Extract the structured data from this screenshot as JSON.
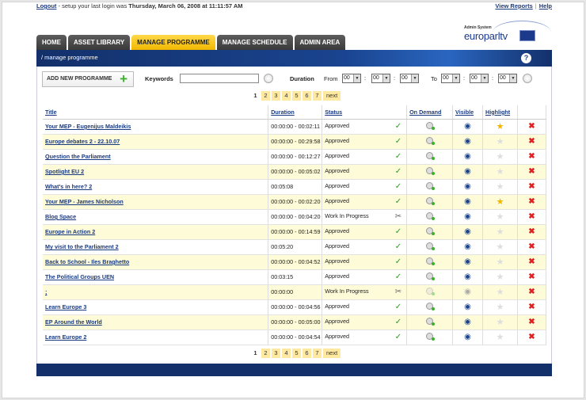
{
  "topbar": {
    "logout": "Logout",
    "message_prefix": " - setup your last login was ",
    "last_login": "Thursday, March 06, 2008 at 11:11:57 AM",
    "view_reports": "View Reports",
    "sep": "|",
    "help": "Help"
  },
  "tabs": [
    "HOME",
    "ASSET LIBRARY",
    "MANAGE PROGRAMME",
    "MANAGE SCHEDULE",
    "ADMIN AREA"
  ],
  "logo": {
    "small": "Admin System",
    "brand": "europarltv"
  },
  "breadcrumb": "/ manage programme",
  "help_icon": "?",
  "filter": {
    "add_button": "ADD NEW PROGRAMME",
    "keywords_label": "Keywords",
    "keywords_value": "",
    "duration_label": "Duration",
    "from_label": "From",
    "to_label": "To",
    "from": [
      "00",
      "00",
      "00"
    ],
    "to": [
      "00",
      "00",
      "00"
    ],
    "colon": ":"
  },
  "pager": {
    "current": "1",
    "pages": [
      "2",
      "3",
      "4",
      "5",
      "6",
      "7"
    ],
    "next": "next"
  },
  "table": {
    "headers": {
      "title": "Title",
      "duration": "Duration",
      "status": "Status",
      "on_demand": "On Demand",
      "visible": "Visible",
      "highlight": "Highlight"
    },
    "rows": [
      {
        "title": "Your MEP - Eugenijus Maldeikis",
        "duration": "00:00:00 - 00:02:11",
        "status": "Approved",
        "approved": true,
        "highlight": true,
        "od": true,
        "visible": true
      },
      {
        "title": "Europe debates 2 - 22.10.07",
        "duration": "00:00:00 - 00:29:58",
        "status": "Approved",
        "approved": true,
        "highlight": false,
        "od": true,
        "visible": true
      },
      {
        "title": "Question the Parliament",
        "duration": "00:00:00 - 00:12:27",
        "status": "Approved",
        "approved": true,
        "highlight": false,
        "od": true,
        "visible": true
      },
      {
        "title": "Spotlight EU 2",
        "duration": "00:00:00 - 00:05:02",
        "status": "Approved",
        "approved": true,
        "highlight": false,
        "od": true,
        "visible": true
      },
      {
        "title": "What's in here? 2",
        "duration": "00:05:08",
        "status": "Approved",
        "approved": true,
        "highlight": false,
        "od": true,
        "visible": true
      },
      {
        "title": "Your MEP - James Nicholson",
        "duration": "00:00:00 - 00:02:20",
        "status": "Approved",
        "approved": true,
        "highlight": true,
        "od": true,
        "visible": true
      },
      {
        "title": "Blog Space",
        "duration": "00:00:00 - 00:04:20",
        "status": "Work In Progress",
        "approved": false,
        "highlight": false,
        "od": true,
        "visible": true
      },
      {
        "title": "Europe in Action 2",
        "duration": "00:00:00 - 00:14:59",
        "status": "Approved",
        "approved": true,
        "highlight": false,
        "od": true,
        "visible": true
      },
      {
        "title": "My visit to the Parliament 2",
        "duration": "00:05:20",
        "status": "Approved",
        "approved": true,
        "highlight": false,
        "od": true,
        "visible": true
      },
      {
        "title": "Back to School - Iles Braghetto",
        "duration": "00:00:00 - 00:04:52",
        "status": "Approved",
        "approved": true,
        "highlight": false,
        "od": true,
        "visible": true
      },
      {
        "title": "The Political Groups UEN",
        "duration": "00:03:15",
        "status": "Approved",
        "approved": true,
        "highlight": false,
        "od": true,
        "visible": true
      },
      {
        "title": ";",
        "duration": "00:00:00",
        "status": "Work In Progress",
        "approved": false,
        "highlight": false,
        "od": false,
        "visible": false
      },
      {
        "title": "Learn Europe 3",
        "duration": "00:00:00 - 00:04:56",
        "status": "Approved",
        "approved": true,
        "highlight": false,
        "od": true,
        "visible": true
      },
      {
        "title": "EP Around the World",
        "duration": "00:00:00 - 00:05:00",
        "status": "Approved",
        "approved": true,
        "highlight": false,
        "od": true,
        "visible": true
      },
      {
        "title": "Learn Europe 2",
        "duration": "00:00:00 - 00:04:54",
        "status": "Approved",
        "approved": true,
        "highlight": false,
        "od": true,
        "visible": true
      }
    ]
  },
  "colors": {
    "navy": "#13306a",
    "accent_yellow": "#f2b800",
    "row_alt": "#fdfbd8",
    "link": "#1a3a80"
  }
}
